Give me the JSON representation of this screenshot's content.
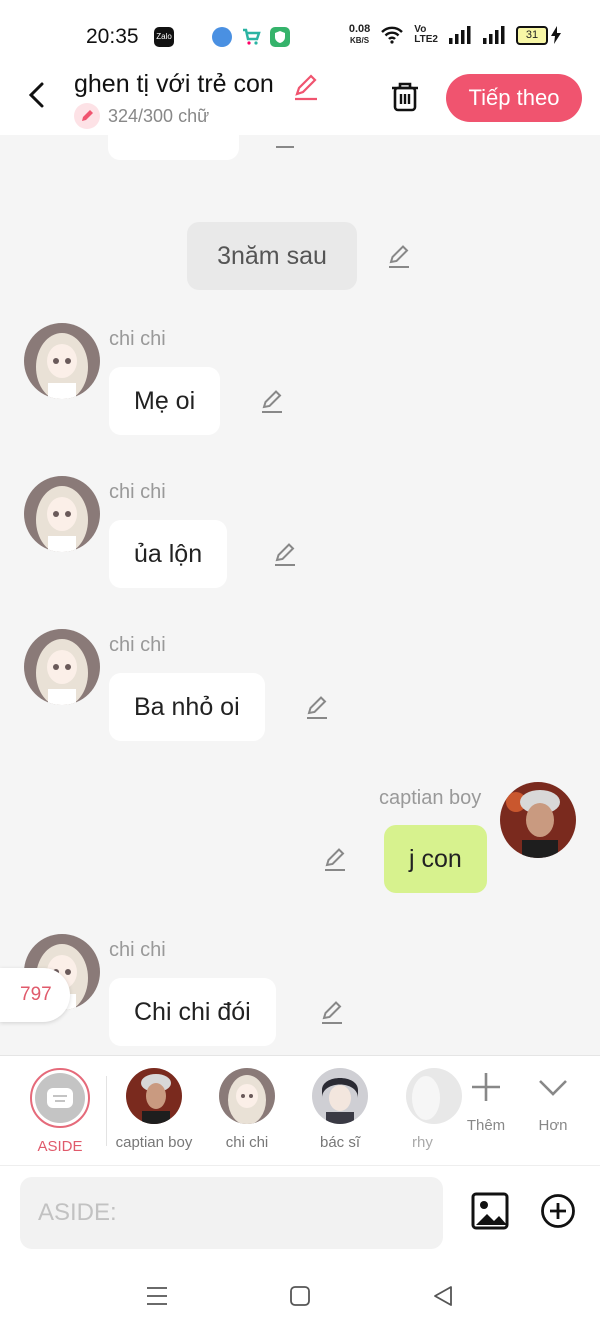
{
  "status_bar": {
    "time": "20:35",
    "app_icons": [
      "zalo-icon",
      "blue-app-icon",
      "shopping-cart-icon",
      "shield-app-icon"
    ],
    "zalo_label": "Zalo",
    "net_speed_value": "0.08",
    "net_speed_unit": "KB/S",
    "volte_top": "Vo",
    "volte_bottom": "LTE2",
    "battery": "31"
  },
  "header": {
    "title": "ghen tị với trẻ con",
    "word_count": "324/300 chữ",
    "next_label": "Tiếp theo",
    "accent": "#f0546f"
  },
  "chat": {
    "top_partial_text": "// ——//",
    "narration": "3năm sau",
    "messages": [
      {
        "sender": "chi chi",
        "text": "Mẹ oi"
      },
      {
        "sender": "chi chi",
        "text": "ủa lộn"
      },
      {
        "sender": "chi chi",
        "text": "Ba nhỏ oi"
      },
      {
        "sender": "captian boy",
        "text": "j con"
      },
      {
        "sender": "chi chi",
        "text": "Chi chi đói"
      }
    ],
    "badge_count": "797"
  },
  "characters": {
    "aside_label": "ASIDE",
    "items": [
      {
        "name": "captian boy"
      },
      {
        "name": "chi chi"
      },
      {
        "name": "bác sĩ"
      },
      {
        "name": "rhy"
      }
    ],
    "add_label": "Thêm",
    "more_label": "Hơn"
  },
  "input": {
    "placeholder": "ASIDE:"
  }
}
